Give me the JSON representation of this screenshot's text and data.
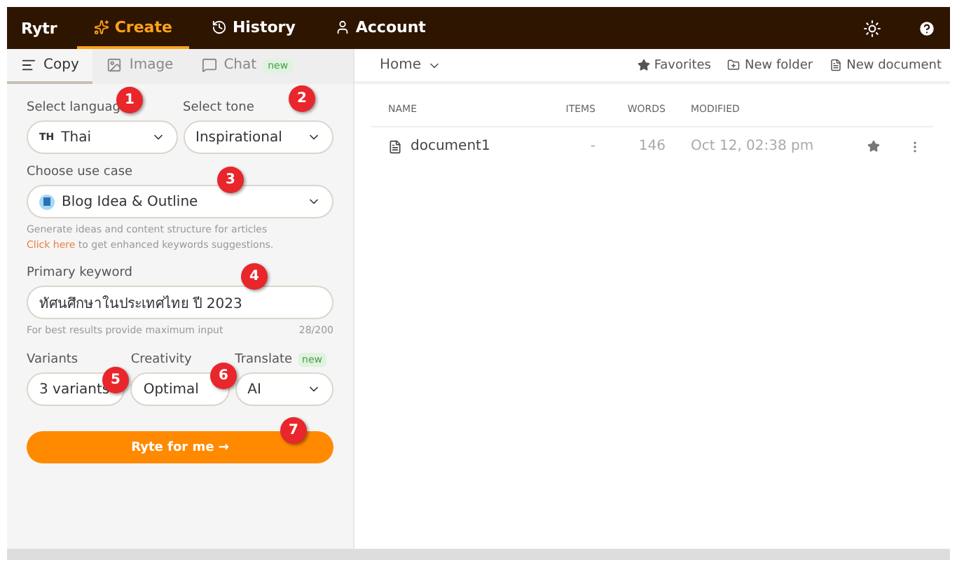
{
  "topbar": {
    "logo": "Rytr",
    "nav": [
      {
        "label": "Create",
        "selected": true
      },
      {
        "label": "History",
        "selected": false
      },
      {
        "label": "Account",
        "selected": false
      }
    ]
  },
  "left_tabs": [
    {
      "label": "Copy",
      "selected": true
    },
    {
      "label": "Image",
      "selected": false
    },
    {
      "label": "Chat",
      "selected": false,
      "badge": "new"
    }
  ],
  "form": {
    "language": {
      "label": "Select languag",
      "prefix": "TH",
      "value": "Thai"
    },
    "tone": {
      "label": "Select tone",
      "value": "Inspirational"
    },
    "use_case": {
      "label": "Choose use case",
      "value": "Blog Idea & Outline",
      "hint": "Generate ideas and content structure for articles",
      "link": "Click here",
      "link_rest": " to get enhanced keywords suggestions."
    },
    "keyword": {
      "label": "Primary keyword",
      "value": "ทัศนศึกษาในประเทศไทย ปี 2023",
      "hint": "For best results provide maximum input",
      "count": "28/200"
    },
    "variants": {
      "label": "Variants",
      "value": "3 variants"
    },
    "creativity": {
      "label": "Creativity",
      "value": "Optimal"
    },
    "translate": {
      "label": "Translate",
      "badge": "new",
      "value": "AI"
    },
    "submit": "Ryte for me →"
  },
  "markers": [
    "1",
    "2",
    "3",
    "4",
    "5",
    "6",
    "7"
  ],
  "right": {
    "breadcrumb": "Home",
    "actions": [
      {
        "label": "Favorites"
      },
      {
        "label": "New folder"
      },
      {
        "label": "New document"
      }
    ],
    "columns": [
      "NAME",
      "ITEMS",
      "WORDS",
      "MODIFIED"
    ],
    "rows": [
      {
        "name": "document1",
        "items": "-",
        "words": "146",
        "modified": "Oct 12, 02:38 pm"
      }
    ]
  }
}
